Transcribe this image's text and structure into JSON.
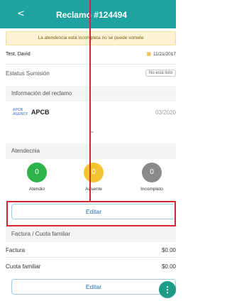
{
  "header": {
    "back_icon": "chevron-left-icon",
    "back_glyph": "<",
    "title": "Reclamo #124494"
  },
  "banner": {
    "text": "La atendencia está incompleta no se puede somete"
  },
  "patient": {
    "name": "Test, David",
    "date": "11/21/2017",
    "calendar_icon": "calendar-icon"
  },
  "estatus": {
    "label": "Estatus Sumisión",
    "badge": "No está listo"
  },
  "claim": {
    "section_title": "Información del reclamo",
    "agency_logo_text": "APCB AGENCY",
    "agency": "APCB",
    "date": "03/2020",
    "expand_icon": "chevron-down-icon"
  },
  "attendance": {
    "section_title": "Atendecnia",
    "items": [
      {
        "label": "Atendio",
        "count": "0",
        "color": "#2eb24b"
      },
      {
        "label": "Ausente",
        "count": "0",
        "color": "#f4c430"
      },
      {
        "label": "Incompleto",
        "count": "0",
        "color": "#8a8a8a"
      }
    ],
    "edit_label": "Editar"
  },
  "billing": {
    "section_title": "Factura / Cuota familiar",
    "rows": [
      {
        "label": "Factura",
        "value": "$0.00"
      },
      {
        "label": "Cuota familiar",
        "value": "$0.00"
      }
    ],
    "edit_label": "Editar"
  },
  "fab": {
    "icon": "more-vertical-icon",
    "glyph": "⋮"
  },
  "colors": {
    "primary": "#1fa3a0",
    "highlight": "#d9232e",
    "link": "#1d6fb0"
  }
}
